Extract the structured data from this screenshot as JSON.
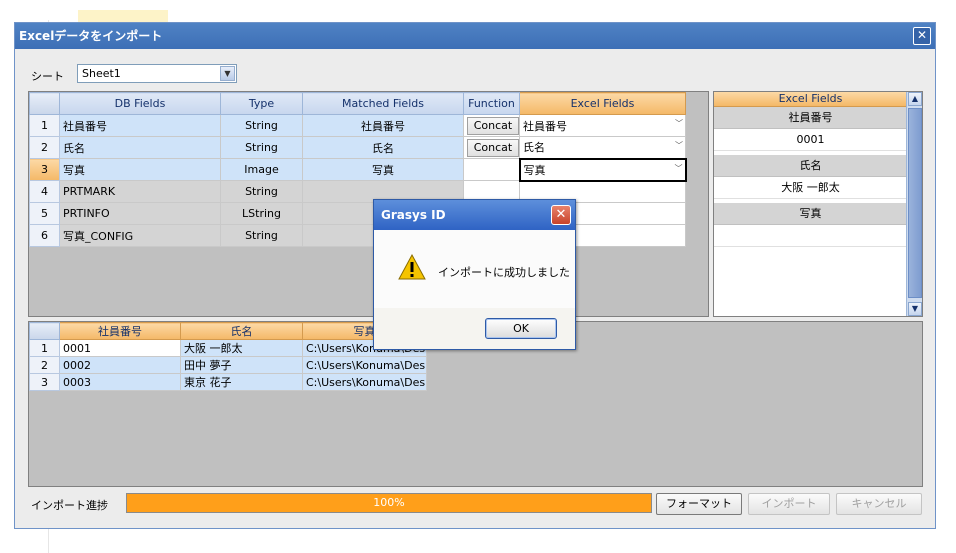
{
  "window": {
    "title": "Excelデータをインポート",
    "close_glyph": "✕"
  },
  "sheet": {
    "label": "シート",
    "value": "Sheet1"
  },
  "mapping": {
    "headers": [
      "DB Fields",
      "Type",
      "Matched Fields",
      "Function",
      "Excel Fields"
    ],
    "rows": [
      {
        "num": "1",
        "db": "社員番号",
        "type": "String",
        "matched": "社員番号",
        "func": "Concat",
        "excel": "社員番号"
      },
      {
        "num": "2",
        "db": "氏名",
        "type": "String",
        "matched": "氏名",
        "func": "Concat",
        "excel": "氏名"
      },
      {
        "num": "3",
        "db": "写真",
        "type": "Image",
        "matched": "写真",
        "func": "",
        "excel": "写真"
      },
      {
        "num": "4",
        "db": "PRTMARK",
        "type": "String",
        "matched": "",
        "func": "",
        "excel": ""
      },
      {
        "num": "5",
        "db": "PRTINFO",
        "type": "LString",
        "matched": "",
        "func": "",
        "excel": ""
      },
      {
        "num": "6",
        "db": "写真_CONFIG",
        "type": "String",
        "matched": "",
        "func": "",
        "excel": ""
      }
    ]
  },
  "excel_panel": {
    "header": "Excel Fields",
    "items": [
      {
        "label": "社員番号",
        "value": "0001"
      },
      {
        "label": "氏名",
        "value": "大阪 一郎太"
      },
      {
        "label": "写真",
        "value": ""
      }
    ]
  },
  "preview": {
    "headers": [
      "社員番号",
      "氏名",
      "写真"
    ],
    "rows": [
      {
        "num": "1",
        "c1": "0001",
        "c2": "大阪 一郎太",
        "c3": "C:\\Users\\Konuma\\Deskt"
      },
      {
        "num": "2",
        "c1": "0002",
        "c2": "田中 夢子",
        "c3": "C:\\Users\\Konuma\\Deskt"
      },
      {
        "num": "3",
        "c1": "0003",
        "c2": "東京 花子",
        "c3": "C:\\Users\\Konuma\\Deskt"
      }
    ]
  },
  "progress": {
    "label": "インポート進捗",
    "value": 100,
    "text": "100%"
  },
  "buttons": {
    "format": "フォーマット",
    "import": "インポート",
    "cancel": "キャンセル"
  },
  "dialog": {
    "title": "Grasys ID",
    "message": "インポートに成功しました",
    "ok": "OK",
    "close_glyph": "✕"
  }
}
